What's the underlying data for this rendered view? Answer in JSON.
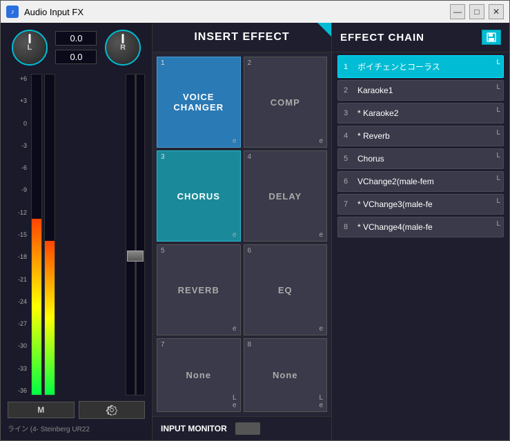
{
  "window": {
    "title": "Audio Input FX",
    "icon_text": "♪"
  },
  "title_buttons": {
    "minimize": "—",
    "maximize": "□",
    "close": "✕"
  },
  "left_panel": {
    "l_label": "L",
    "r_label": "R",
    "value_l": "0.0",
    "value_r": "0.0",
    "db_labels": [
      "+6",
      "+3",
      "0",
      "-3",
      "-6",
      "-9",
      "-12",
      "-15",
      "-18",
      "-21",
      "-24",
      "-27",
      "-30",
      "-33",
      "-36"
    ],
    "m_button": "M",
    "input_label": "ライン (4- Steinberg UR22"
  },
  "middle_panel": {
    "header": "INSERT EFFECT",
    "effects": [
      {
        "num": "1",
        "name": "VOICE\nCHANGER",
        "active": true,
        "type": "blue"
      },
      {
        "num": "2",
        "name": "COMP",
        "active": false,
        "type": "normal"
      },
      {
        "num": "3",
        "name": "CHORUS",
        "active": true,
        "type": "teal"
      },
      {
        "num": "4",
        "name": "DELAY",
        "active": false,
        "type": "normal"
      },
      {
        "num": "5",
        "name": "REVERB",
        "active": false,
        "type": "normal"
      },
      {
        "num": "6",
        "name": "EQ",
        "active": false,
        "type": "normal"
      },
      {
        "num": "7",
        "name": "None",
        "active": false,
        "type": "empty"
      },
      {
        "num": "8",
        "name": "None",
        "active": false,
        "type": "empty"
      }
    ],
    "input_monitor": "INPUT MONITOR"
  },
  "right_panel": {
    "header": "EFFECT CHAIN",
    "chain_items": [
      {
        "num": "1",
        "name": "ボイチェンとコーラス",
        "selected": true
      },
      {
        "num": "2",
        "name": "Karaoke1",
        "selected": false
      },
      {
        "num": "3",
        "name": "* Karaoke2",
        "selected": false
      },
      {
        "num": "4",
        "name": "* Reverb",
        "selected": false
      },
      {
        "num": "5",
        "name": "Chorus",
        "selected": false
      },
      {
        "num": "6",
        "name": "VChange2(male-fem",
        "selected": false
      },
      {
        "num": "7",
        "name": "* VChange3(male-fe",
        "selected": false
      },
      {
        "num": "8",
        "name": "* VChange4(male-fe",
        "selected": false
      }
    ]
  }
}
